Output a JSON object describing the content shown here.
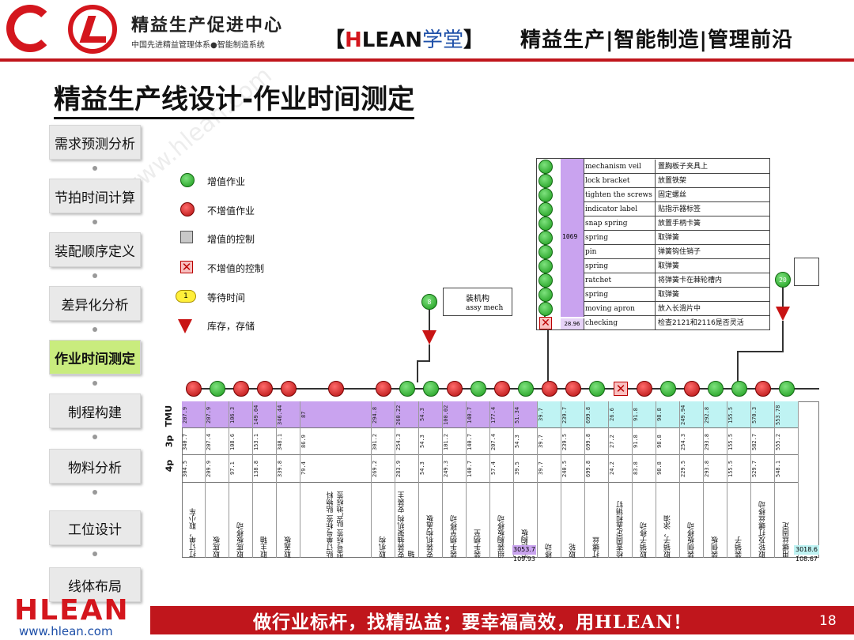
{
  "header": {
    "brand_name": "精益生产促进中心",
    "brand_sub": "中国先进精益管理体系●智能制造系统",
    "hlean_open": "【",
    "hlean_h": "H",
    "hlean_rest": "LEAN",
    "hlean_school": "学堂",
    "hlean_close": "】",
    "tagline": "精益生产|智能制造|管理前沿"
  },
  "title": "精益生产线设计-作业时间测定",
  "watermark": "www.hlean.com",
  "sidebar": {
    "items": [
      {
        "label": "需求预测分析",
        "active": false
      },
      {
        "label": "节拍时间计算",
        "active": false
      },
      {
        "label": "装配顺序定义",
        "active": false
      },
      {
        "label": "差异化分析",
        "active": false
      },
      {
        "label": "作业时间测定",
        "active": true
      },
      {
        "label": "制程构建",
        "active": false
      },
      {
        "label": "物料分析",
        "active": false
      },
      {
        "label": "工位设计",
        "active": false
      },
      {
        "label": "线体布局",
        "active": false
      }
    ]
  },
  "legend": [
    {
      "icon": "green-circle",
      "label": "增值作业"
    },
    {
      "icon": "red-circle",
      "label": "不增值作业"
    },
    {
      "icon": "grey-square",
      "label": "增值的控制"
    },
    {
      "icon": "red-x-square",
      "label": "不增值的控制"
    },
    {
      "icon": "yellow-lozenge",
      "label": "等待时间"
    },
    {
      "icon": "red-triangle",
      "label": "库存，存储"
    }
  ],
  "diagram": {
    "row_labels": [
      "TMU",
      "3p",
      "4p"
    ],
    "assembly_box": {
      "cn": "装机构",
      "en": "assy mech"
    },
    "detail_time": "1069",
    "detail_check_time": "28.96",
    "detail_rows": [
      {
        "en": "mechanism veil",
        "cn": "置胸板子夹具上"
      },
      {
        "en": "lock bracket",
        "cn": "放置铁架"
      },
      {
        "en": "tighten the screws",
        "cn": "固定螺丝"
      },
      {
        "en": "indicator label",
        "cn": "贴指示器标签"
      },
      {
        "en": "snap spring",
        "cn": "放置手柄卡簧"
      },
      {
        "en": "spring",
        "cn": "取弹簧"
      },
      {
        "en": "pin",
        "cn": "弹簧钩住销子"
      },
      {
        "en": "spring",
        "cn": "取弹簧"
      },
      {
        "en": "ratchet",
        "cn": "将弹簧卡在棘轮槽内"
      },
      {
        "en": "spring",
        "cn": "取弹簧"
      },
      {
        "en": "moving apron",
        "cn": "放入长滑片中"
      },
      {
        "en": "checking",
        "cn": "检查2121和2116是否灵活"
      }
    ],
    "columns": [
      {
        "tmu": "207.9",
        "p3": "340.7",
        "p4": "304.5",
        "desc": "打订单，取小车",
        "color": "purple"
      },
      {
        "tmu": "207.9",
        "p3": "207.4",
        "p4": "209.9",
        "desc": "取底板",
        "color": "purple"
      },
      {
        "tmu": "106.3",
        "p3": "108.6",
        "p4": "97.1",
        "desc": "取底板移动",
        "color": "purple"
      },
      {
        "tmu": "149.04",
        "p3": "153.1",
        "p4": "138.8",
        "desc": "取主轴",
        "color": "purple"
      },
      {
        "tmu": "346.44",
        "p3": "348.1",
        "p4": "339.8",
        "desc": "取盖板",
        "color": "purple"
      },
      {
        "tmu": "87",
        "p3": "86.9",
        "p4": "79.4",
        "desc": "贴订单号标签 贴物料型号标签 贴产地标签",
        "color": "purple",
        "wide": true
      },
      {
        "tmu": "294.8",
        "p3": "301.2",
        "p4": "269.2",
        "desc": "取机构",
        "color": "purple"
      },
      {
        "tmu": "260.22",
        "p3": "254.3",
        "p4": "283.9",
        "desc": "安装抽架机构 安装主轴",
        "color": "purple"
      },
      {
        "tmu": "54.3",
        "p3": "54.3",
        "p4": "54.3",
        "desc": "安装机构盖板",
        "color": "purple"
      },
      {
        "tmu": "100.02",
        "p3": "101.2",
        "p4": "249.3",
        "desc": "装手柄至移动",
        "color": "purple"
      },
      {
        "tmu": "140.7",
        "p3": "140.7",
        "p4": "140.7",
        "desc": "装手柄至",
        "color": "purple"
      },
      {
        "tmu": "177.4",
        "p3": "207.4",
        "p4": "57.4",
        "desc": "组装胸板移动",
        "color": "purple"
      },
      {
        "tmu": "51.34",
        "p3": "54.3",
        "p4": "39.5",
        "desc": "安装胸板",
        "color": "purple"
      },
      {
        "tmu": "39.7",
        "p3": "39.7",
        "p4": "39.7",
        "desc": "移动",
        "color": "cyan"
      },
      {
        "tmu": "239.7",
        "p3": "239.5",
        "p4": "240.5",
        "desc": "取轮",
        "color": "cyan"
      },
      {
        "tmu": "699.8",
        "p3": "699.8",
        "p4": "699.8",
        "desc": "打螺丝",
        "color": "cyan"
      },
      {
        "tmu": "26.6",
        "p3": "27.2",
        "p4": "24.2",
        "desc": "检查固定盖和销钉",
        "color": "cyan"
      },
      {
        "tmu": "91.8",
        "p3": "91.8",
        "p4": "83.8",
        "desc": "取销子移动",
        "color": "cyan"
      },
      {
        "tmu": "98.8",
        "p3": "98.8",
        "p4": "98.8",
        "desc": "取销子，涂油",
        "color": "cyan"
      },
      {
        "tmu": "249.94",
        "p3": "254.3",
        "p4": "229.5",
        "desc": "装侧板移动",
        "color": "cyan"
      },
      {
        "tmu": "292.8",
        "p3": "293.8",
        "p4": "293.8",
        "desc": "装侧板",
        "color": "cyan"
      },
      {
        "tmu": "155.5",
        "p3": "155.5",
        "p4": "155.5",
        "desc": "装销子",
        "color": "cyan"
      },
      {
        "tmu": "570.3",
        "p3": "582.7",
        "p4": "529.7",
        "desc": "取轮及打螺丝移动",
        "color": "cyan"
      },
      {
        "tmu": "553.78",
        "p3": "555.2",
        "p4": "548.1",
        "desc": "用螺丝固定",
        "color": "cyan"
      }
    ],
    "totals": [
      {
        "sum": "3053.7",
        "avg": "109.93"
      },
      {
        "sum": "3018.6",
        "avg": "108.67"
      }
    ]
  },
  "footer": {
    "logo": "HLEAN",
    "url": "www.hlean.com",
    "slogan": "做行业标杆，找精弘益；要幸福高效，用HLEAN！",
    "page_number": "18"
  }
}
